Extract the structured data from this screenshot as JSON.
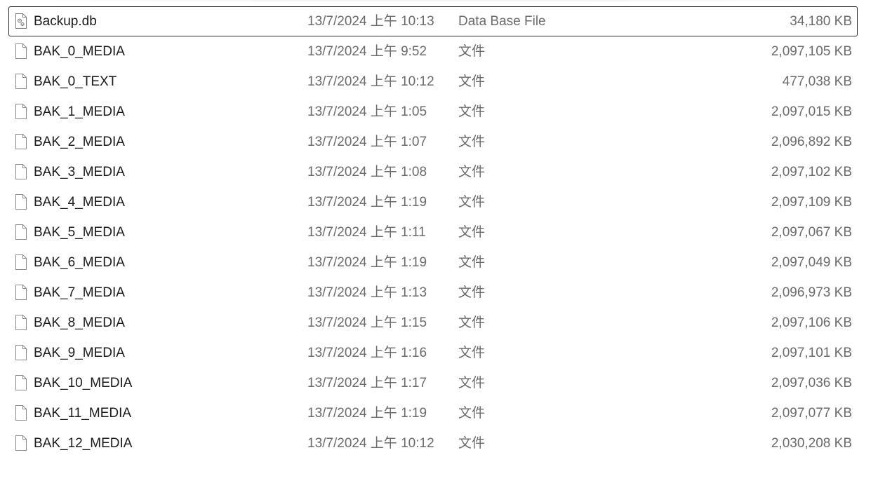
{
  "files": [
    {
      "name": "Backup.db",
      "date": "13/7/2024 上午 10:13",
      "type": "Data Base File",
      "size": "34,180 KB",
      "icon": "database-file-icon",
      "focused": true
    },
    {
      "name": "BAK_0_MEDIA",
      "date": "13/7/2024 上午 9:52",
      "type": "文件",
      "size": "2,097,105 KB",
      "icon": "generic-file-icon",
      "focused": false
    },
    {
      "name": "BAK_0_TEXT",
      "date": "13/7/2024 上午 10:12",
      "type": "文件",
      "size": "477,038 KB",
      "icon": "generic-file-icon",
      "focused": false
    },
    {
      "name": "BAK_1_MEDIA",
      "date": "13/7/2024 上午 1:05",
      "type": "文件",
      "size": "2,097,015 KB",
      "icon": "generic-file-icon",
      "focused": false
    },
    {
      "name": "BAK_2_MEDIA",
      "date": "13/7/2024 上午 1:07",
      "type": "文件",
      "size": "2,096,892 KB",
      "icon": "generic-file-icon",
      "focused": false
    },
    {
      "name": "BAK_3_MEDIA",
      "date": "13/7/2024 上午 1:08",
      "type": "文件",
      "size": "2,097,102 KB",
      "icon": "generic-file-icon",
      "focused": false
    },
    {
      "name": "BAK_4_MEDIA",
      "date": "13/7/2024 上午 1:19",
      "type": "文件",
      "size": "2,097,109 KB",
      "icon": "generic-file-icon",
      "focused": false
    },
    {
      "name": "BAK_5_MEDIA",
      "date": "13/7/2024 上午 1:11",
      "type": "文件",
      "size": "2,097,067 KB",
      "icon": "generic-file-icon",
      "focused": false
    },
    {
      "name": "BAK_6_MEDIA",
      "date": "13/7/2024 上午 1:19",
      "type": "文件",
      "size": "2,097,049 KB",
      "icon": "generic-file-icon",
      "focused": false
    },
    {
      "name": "BAK_7_MEDIA",
      "date": "13/7/2024 上午 1:13",
      "type": "文件",
      "size": "2,096,973 KB",
      "icon": "generic-file-icon",
      "focused": false
    },
    {
      "name": "BAK_8_MEDIA",
      "date": "13/7/2024 上午 1:15",
      "type": "文件",
      "size": "2,097,106 KB",
      "icon": "generic-file-icon",
      "focused": false
    },
    {
      "name": "BAK_9_MEDIA",
      "date": "13/7/2024 上午 1:16",
      "type": "文件",
      "size": "2,097,101 KB",
      "icon": "generic-file-icon",
      "focused": false
    },
    {
      "name": "BAK_10_MEDIA",
      "date": "13/7/2024 上午 1:17",
      "type": "文件",
      "size": "2,097,036 KB",
      "icon": "generic-file-icon",
      "focused": false
    },
    {
      "name": "BAK_11_MEDIA",
      "date": "13/7/2024 上午 1:19",
      "type": "文件",
      "size": "2,097,077 KB",
      "icon": "generic-file-icon",
      "focused": false
    },
    {
      "name": "BAK_12_MEDIA",
      "date": "13/7/2024 上午 10:12",
      "type": "文件",
      "size": "2,030,208 KB",
      "icon": "generic-file-icon",
      "focused": false
    }
  ],
  "colors": {
    "name_text": "#1a1a1a",
    "detail_text": "#6b6b6b",
    "focus_border": "#2b2b2b",
    "background": "#ffffff"
  }
}
